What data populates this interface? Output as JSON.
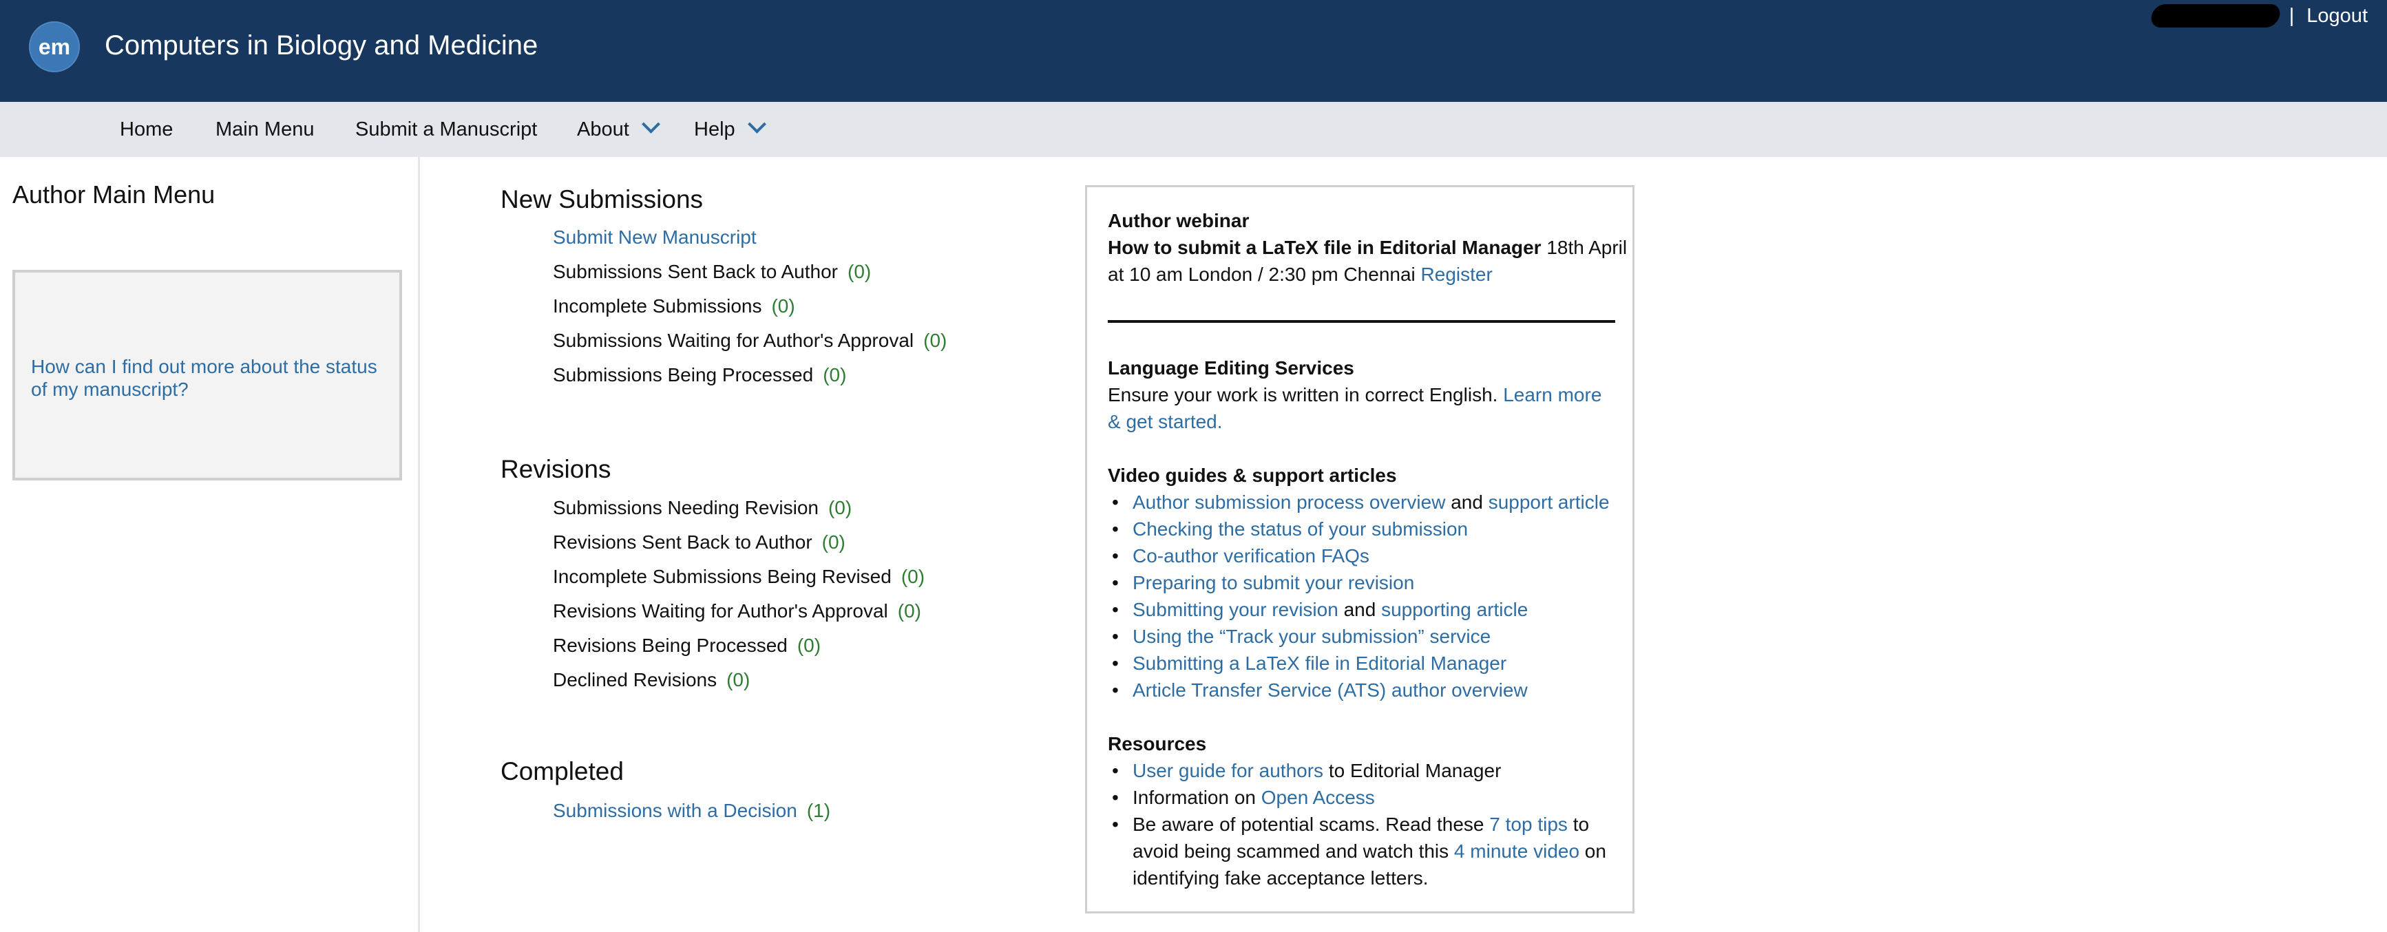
{
  "header": {
    "logo_text": "em",
    "journal_title": "Computers in Biology and Medicine",
    "user_separator": "|",
    "logout_label": "Logout"
  },
  "nav": {
    "home": "Home",
    "main_menu": "Main Menu",
    "submit": "Submit a Manuscript",
    "about": "About",
    "help": "Help"
  },
  "left": {
    "title": "Author Main Menu",
    "help_link": "How can I find out more about the status of my manuscript?"
  },
  "sections": {
    "new_title": "New Submissions",
    "new_submit_link": "Submit New Manuscript",
    "new_items": [
      {
        "label": "Submissions Sent Back to Author",
        "count": "(0)"
      },
      {
        "label": "Incomplete Submissions",
        "count": "(0)"
      },
      {
        "label": "Submissions Waiting for Author's Approval",
        "count": "(0)"
      },
      {
        "label": "Submissions Being Processed",
        "count": "(0)"
      }
    ],
    "revisions_title": "Revisions",
    "revision_items": [
      {
        "label": "Submissions Needing Revision",
        "count": "(0)"
      },
      {
        "label": "Revisions Sent Back to Author",
        "count": "(0)"
      },
      {
        "label": "Incomplete Submissions Being Revised",
        "count": "(0)"
      },
      {
        "label": "Revisions Waiting for Author's Approval",
        "count": "(0)"
      },
      {
        "label": "Revisions Being Processed",
        "count": "(0)"
      },
      {
        "label": "Declined Revisions",
        "count": "(0)"
      }
    ],
    "completed_title": "Completed",
    "completed_items": [
      {
        "label": "Submissions with a Decision",
        "count": "(1)"
      }
    ]
  },
  "panel": {
    "webinar_heading": "Author webinar",
    "webinar_bold": "How to submit a LaTeX file in Editorial Manager",
    "webinar_rest_1": " 18th April",
    "webinar_line2": "at 10 am London / 2:30 pm Chennai ",
    "webinar_register": "Register",
    "lang_heading": "Language Editing Services",
    "lang_text": "Ensure your work is written in correct English. ",
    "lang_link_1": "Learn more",
    "lang_link_2": "& get started.",
    "video_heading": "Video guides & support articles",
    "video_1a": "Author submission process overview",
    "video_1and": " and ",
    "video_1b": "support article",
    "video_2": "Checking the status of your submission",
    "video_3": "Co-author verification FAQs",
    "video_4": "Preparing to submit your revision",
    "video_5a": "Submitting your revision",
    "video_5and": " and ",
    "video_5b": "supporting article",
    "video_6": "Using the “Track your submission” service",
    "video_7": "Submitting a LaTeX file in Editorial Manager",
    "video_8": "Article Transfer Service (ATS) author overview",
    "res_heading": "Resources",
    "res_1a": "User guide for authors",
    "res_1b": " to Editorial Manager",
    "res_2a": "Information on ",
    "res_2b": "Open Access",
    "res_3a": "Be aware of potential scams. Read these ",
    "res_3b": "7 top tips",
    "res_3c": " to",
    "res_3d": "avoid being scammed and watch this ",
    "res_3e": "4 minute video",
    "res_3f": " on",
    "res_3g": "identifying fake acceptance letters."
  },
  "colors": {
    "header_bg": "#17375e",
    "nav_bg": "#e3e6ea",
    "link": "#2e6da4",
    "count": "#2e7d32"
  }
}
